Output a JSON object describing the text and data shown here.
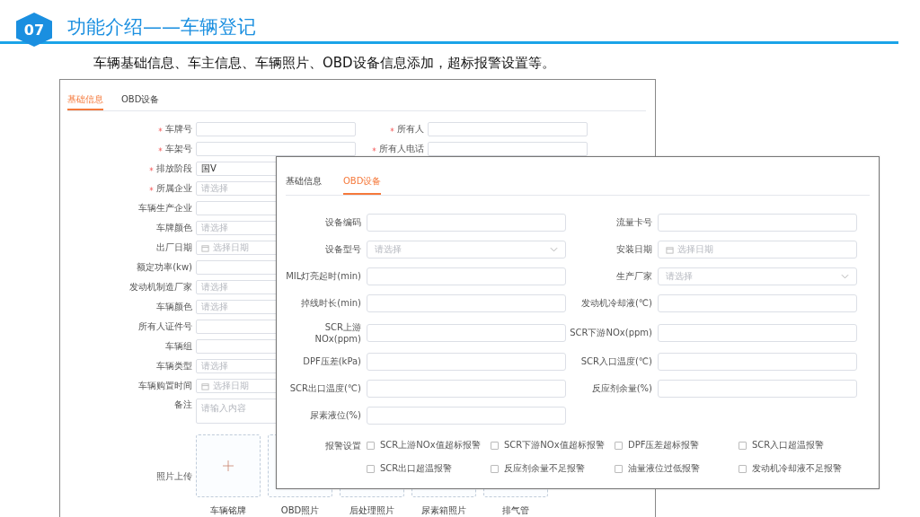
{
  "header": {
    "number": "07",
    "title": "功能介绍——车辆登记",
    "subtitle": "车辆基础信息、车主信息、车辆照片、OBD设备信息添加，超标报警设置等。"
  },
  "back_window": {
    "tabs": [
      {
        "label": "基础信息",
        "selected": true
      },
      {
        "label": "OBD设备",
        "selected": false
      }
    ],
    "left_fields": [
      {
        "label": "车牌号",
        "required": true,
        "kind": "input"
      },
      {
        "label": "车架号",
        "required": true,
        "kind": "input"
      },
      {
        "label": "排放阶段",
        "required": true,
        "kind": "input",
        "value": "国V"
      },
      {
        "label": "所属企业",
        "required": true,
        "kind": "input",
        "placeholder": "请选择"
      },
      {
        "label": "车辆生产企业",
        "required": false,
        "kind": "input"
      },
      {
        "label": "车牌颜色",
        "required": false,
        "kind": "input",
        "placeholder": "请选择"
      },
      {
        "label": "出厂日期",
        "required": false,
        "kind": "date",
        "placeholder": "选择日期"
      },
      {
        "label": "额定功率(kw)",
        "required": false,
        "kind": "input"
      },
      {
        "label": "发动机制造厂家",
        "required": false,
        "kind": "input",
        "placeholder": "请选择"
      },
      {
        "label": "车辆颜色",
        "required": false,
        "kind": "input",
        "placeholder": "请选择"
      },
      {
        "label": "所有人证件号",
        "required": false,
        "kind": "input"
      },
      {
        "label": "车辆组",
        "required": false,
        "kind": "input"
      },
      {
        "label": "车辆类型",
        "required": false,
        "kind": "input",
        "placeholder": "请选择"
      },
      {
        "label": "车辆购置时间",
        "required": false,
        "kind": "date",
        "placeholder": "选择日期"
      },
      {
        "label": "备注",
        "required": false,
        "kind": "textarea",
        "placeholder": "请输入内容"
      }
    ],
    "right_fields": [
      {
        "label": "所有人",
        "required": true
      },
      {
        "label": "所有人电话",
        "required": true
      }
    ],
    "upload": {
      "label": "照片上传",
      "photos": [
        "车辆铭牌",
        "OBD照片",
        "后处理照片",
        "尿素箱照片",
        "排气管"
      ]
    }
  },
  "front_window": {
    "tabs": [
      {
        "label": "基础信息",
        "selected": false
      },
      {
        "label": "OBD设备",
        "selected": true
      }
    ],
    "left_fields": [
      {
        "label": "设备编码",
        "kind": "input"
      },
      {
        "label": "设备型号",
        "kind": "select",
        "placeholder": "请选择"
      },
      {
        "label": "MIL灯亮起时(min)",
        "kind": "input"
      },
      {
        "label": "掉线时长(min)",
        "kind": "input"
      },
      {
        "label": "SCR上游NOx(ppm)",
        "kind": "input"
      },
      {
        "label": "DPF压差(kPa)",
        "kind": "input"
      },
      {
        "label": "SCR出口温度(℃)",
        "kind": "input"
      },
      {
        "label": "尿素液位(%)",
        "kind": "input"
      }
    ],
    "right_fields": [
      {
        "label": "流量卡号",
        "kind": "input"
      },
      {
        "label": "安装日期",
        "kind": "date",
        "placeholder": "选择日期"
      },
      {
        "label": "生产厂家",
        "kind": "select",
        "placeholder": "请选择"
      },
      {
        "label": "发动机冷却液(℃)",
        "kind": "input"
      },
      {
        "label": "SCR下游NOx(ppm)",
        "kind": "input"
      },
      {
        "label": "SCR入口温度(℃)",
        "kind": "input"
      },
      {
        "label": "反应剂余量(%)",
        "kind": "input"
      }
    ],
    "alarm": {
      "label": "报警设置",
      "options": [
        {
          "label": "SCR上游NOx值超标报警",
          "checked": false
        },
        {
          "label": "SCR下游NOx值超标报警",
          "checked": false
        },
        {
          "label": "DPF压差超标报警",
          "checked": false
        },
        {
          "label": "SCR入口超温报警",
          "checked": false
        },
        {
          "label": "SCR出口超温报警",
          "checked": false
        },
        {
          "label": "反应剂余量不足报警",
          "checked": false
        },
        {
          "label": "油量液位过低报警",
          "checked": false
        },
        {
          "label": "发动机冷却液不足报警",
          "checked": false
        }
      ]
    }
  }
}
